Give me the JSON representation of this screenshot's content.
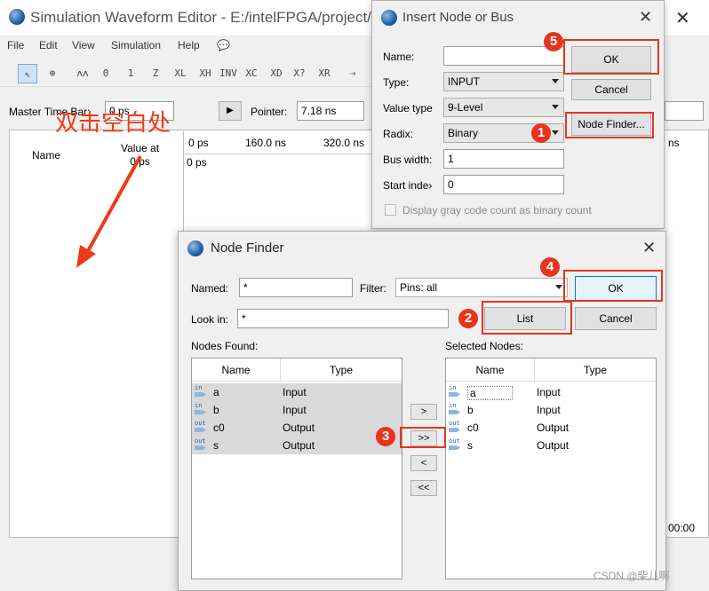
{
  "main": {
    "title": "Simulation Waveform Editor - E:/intelFPGA/project/o",
    "menu": [
      "File",
      "Edit",
      "View",
      "Simulation",
      "Help"
    ],
    "master_time_bar_label": "Master Time Bar:",
    "master_time_bar_value": "0 ps",
    "pointer_label": "Pointer:",
    "pointer_value": "7.18 ns",
    "name_header": "Name",
    "value_at_header": "Value at",
    "value_at_sub": "0 ps",
    "ruler": [
      "0 ps",
      "160.0 ns",
      "320.0 ns"
    ],
    "ruler_start": "0 ps",
    "ruler_right": "ns",
    "status_right": "00:00",
    "annotation": "双击空白处"
  },
  "insert": {
    "title": "Insert Node or Bus",
    "name_label": "Name:",
    "name_value": "",
    "type_label": "Type:",
    "type_value": "INPUT",
    "value_type_label": "Value type",
    "value_type_value": "9-Level",
    "radix_label": "Radix:",
    "radix_value": "Binary",
    "bus_width_label": "Bus width:",
    "bus_width_value": "1",
    "start_index_label": "Start inde›",
    "start_index_value": "0",
    "gray_code_label": "Display gray code count as binary count",
    "ok": "OK",
    "cancel": "Cancel",
    "node_finder": "Node Finder..."
  },
  "finder": {
    "title": "Node Finder",
    "named_label": "Named:",
    "named_value": "*",
    "filter_label": "Filter:",
    "filter_value": "Pins: all",
    "look_in_label": "Look in:",
    "look_in_value": "*",
    "list": "List",
    "ok": "OK",
    "cancel": "Cancel",
    "nodes_found_label": "Nodes Found:",
    "selected_nodes_label": "Selected Nodes:",
    "col_name": "Name",
    "col_type": "Type",
    "nodes": [
      {
        "dir": "in",
        "name": "a",
        "type": "Input"
      },
      {
        "dir": "in",
        "name": "b",
        "type": "Input"
      },
      {
        "dir": "out",
        "name": "c0",
        "type": "Output"
      },
      {
        "dir": "out",
        "name": "s",
        "type": "Output"
      }
    ],
    "selected": [
      {
        "dir": "in",
        "name": "a",
        "type": "Input"
      },
      {
        "dir": "in",
        "name": "b",
        "type": "Input"
      },
      {
        "dir": "out",
        "name": "c0",
        "type": "Output"
      },
      {
        "dir": "out",
        "name": "s",
        "type": "Output"
      }
    ],
    "move_buttons": [
      ">",
      ">>",
      "<",
      "<<"
    ]
  },
  "badges": [
    "1",
    "2",
    "3",
    "4",
    "5"
  ],
  "watermark": "CSDN @柴儿啊",
  "colors": {
    "annotation_red": "#e8341c",
    "selection_blue": "#cfe3f7"
  }
}
